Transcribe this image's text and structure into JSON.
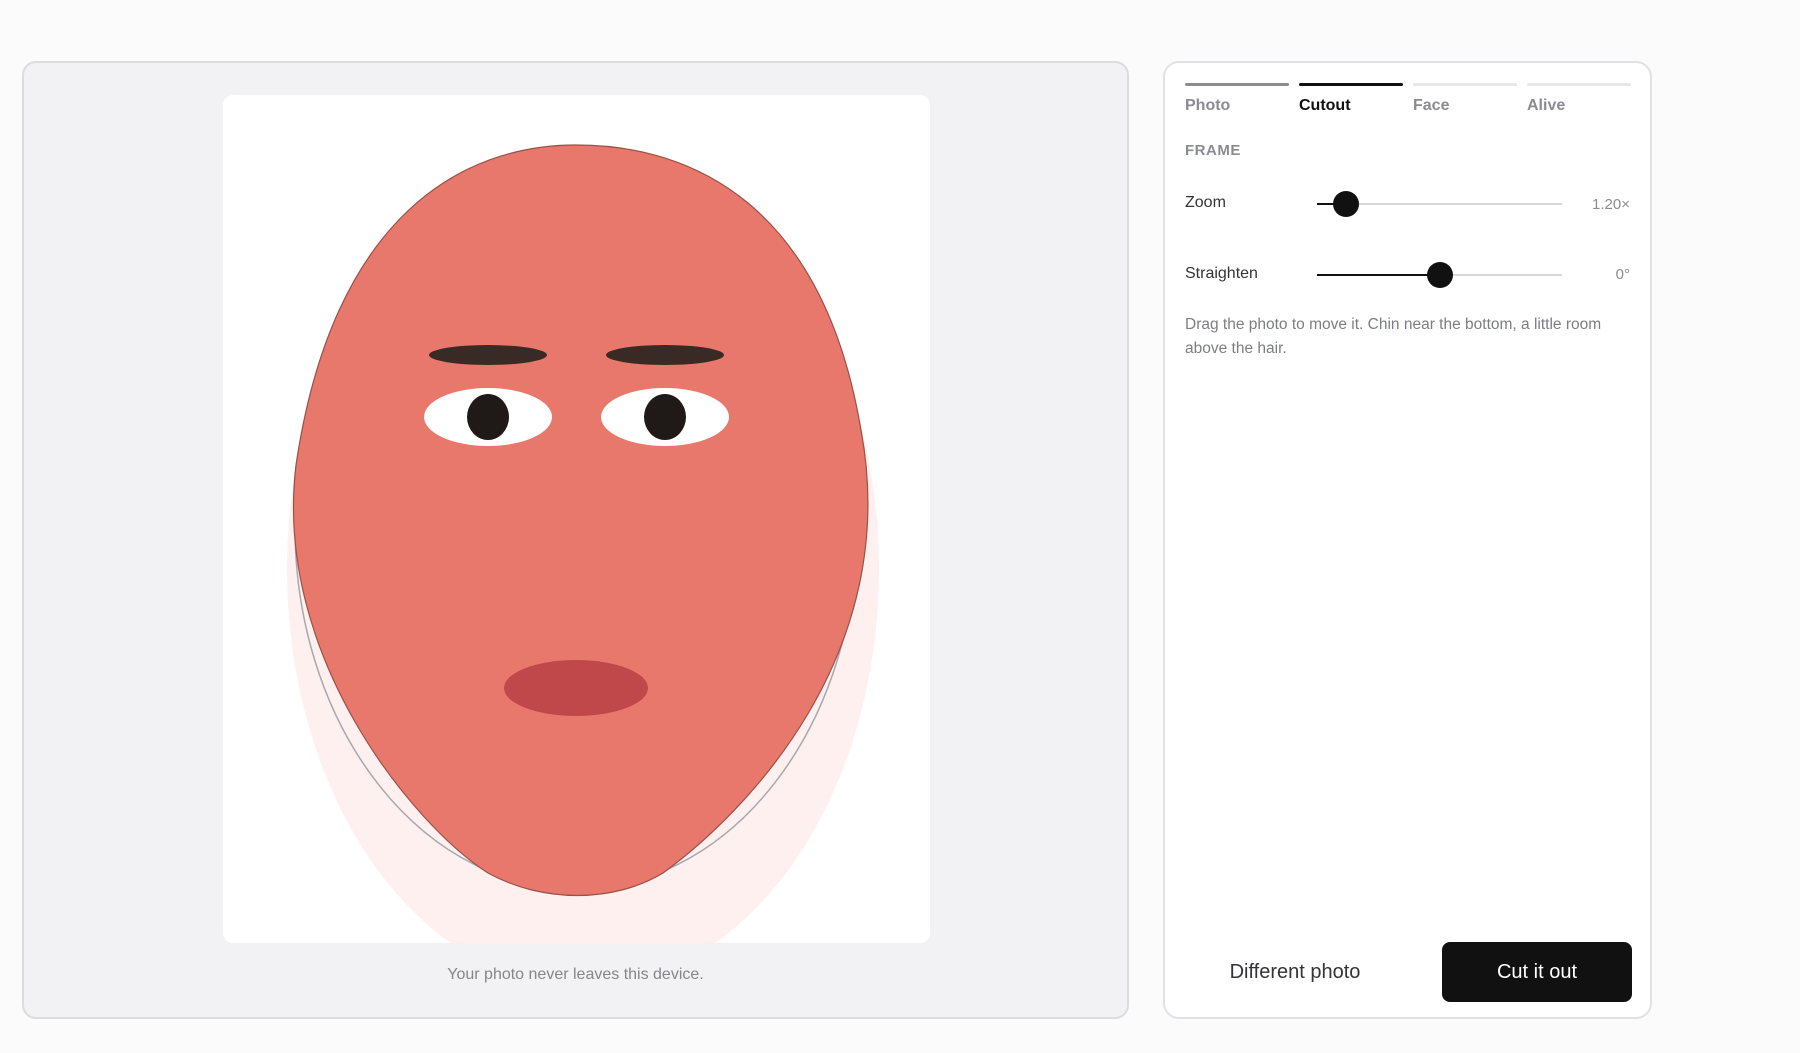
{
  "preview": {
    "caption": "Your photo never leaves this device."
  },
  "panel": {
    "tabs": [
      {
        "label": "Photo",
        "state": "done"
      },
      {
        "label": "Cutout",
        "state": "active"
      },
      {
        "label": "Face",
        "state": "pending"
      },
      {
        "label": "Alive",
        "state": "pending"
      }
    ],
    "section_title": "FRAME",
    "zoom": {
      "label": "Zoom",
      "value": "1.20×",
      "fraction": 0.12
    },
    "straighten": {
      "label": "Straighten",
      "value": "0°",
      "fraction": 0.5
    },
    "hint": "Drag the photo to move it. Chin near the bottom, a little room above the hair.",
    "secondary_button": "Different photo",
    "primary_button": "Cut it out"
  },
  "colors": {
    "skin": "#e8786b",
    "lips": "#c0484a",
    "brows": "#3a2a26",
    "accent": "#111111"
  },
  "icons": [
    "face-illustration"
  ]
}
